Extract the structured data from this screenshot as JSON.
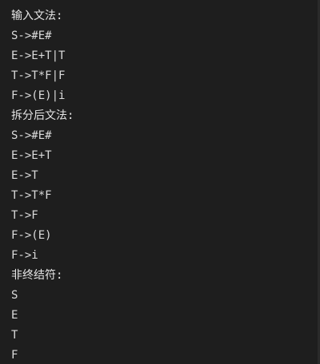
{
  "terminal": {
    "top_fragment": "· · · · : · · · · · · · · ·",
    "lines": [
      "输入文法:",
      "S->#E#",
      "E->E+T|T",
      "T->T*F|F",
      "F->(E)|i",
      "拆分后文法:",
      "S->#E#",
      "E->E+T",
      "E->T",
      "T->T*F",
      "T->F",
      "F->(E)",
      "F->i",
      "非终结符:",
      "S",
      "E",
      "T",
      "F"
    ]
  },
  "colors": {
    "background": "#1e1e1e",
    "text": "#dcdcdc"
  }
}
